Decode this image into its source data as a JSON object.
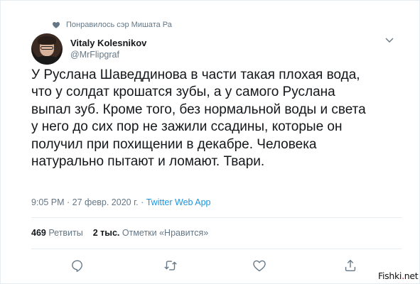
{
  "liked_by": "Понравилось сэр Мишата Ра",
  "author": {
    "name": "Vitaly Kolesnikov",
    "handle": "@MrFlipgraf"
  },
  "tweet_lines": [
    "У Руслана Шаведдинова в части такая плохая вода,",
    "что у солдат крошатся зубы, а у самого Руслана",
    "выпал зуб. Кроме того, без нормальной воды и света",
    "у него до сих пор не зажили ссадины, которые он",
    "получил при похищении в декабре. Человека",
    "натурально пытают и ломают. Твари."
  ],
  "meta": {
    "time_date": "9:05 PM · 27 февр. 2020 г. · ",
    "app": "Twitter Web App"
  },
  "stats": {
    "retweets_count": "469",
    "retweets_label": "Ретвиты",
    "likes_count": "2 тыс.",
    "likes_label": "Отметки «Нравится»"
  },
  "icons": {
    "liked": "heart-icon",
    "menu": "chevron-down-icon",
    "reply": "reply-icon",
    "retweet": "retweet-icon",
    "like": "heart-icon",
    "share": "share-icon"
  },
  "watermark": {
    "prefix": "Fishki",
    "dot": ".",
    "suffix": "net"
  },
  "colors": {
    "text": "#14171a",
    "secondary": "#657786",
    "link": "#1b95e0",
    "border": "#e6ecf0"
  }
}
